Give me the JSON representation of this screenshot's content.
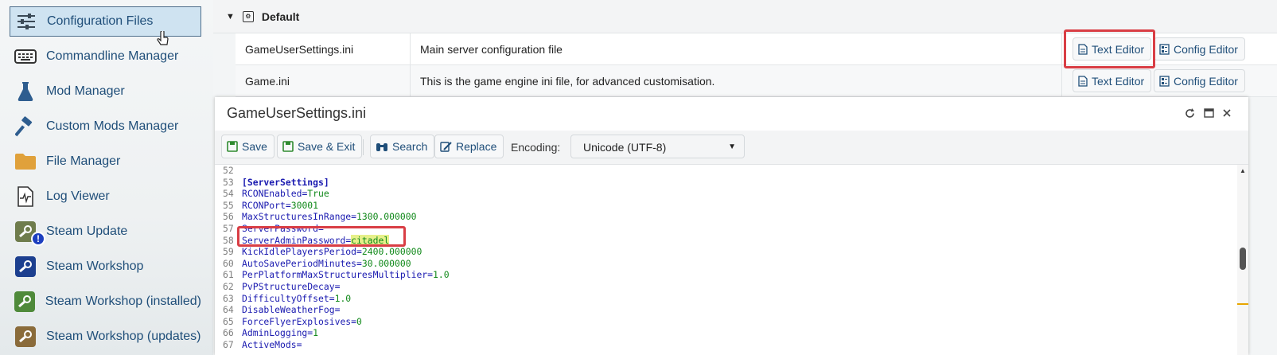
{
  "sidebar": {
    "items": [
      {
        "label": "Configuration Files",
        "icon": "sliders-icon",
        "active": true
      },
      {
        "label": "Commandline Manager",
        "icon": "keyboard-icon"
      },
      {
        "label": "Mod Manager",
        "icon": "flask-icon"
      },
      {
        "label": "Custom Mods Manager",
        "icon": "hammer-icon"
      },
      {
        "label": "File Manager",
        "icon": "folder-icon"
      },
      {
        "label": "Log Viewer",
        "icon": "log-file-icon"
      },
      {
        "label": "Steam Update",
        "icon": "steam-update-icon",
        "badge": "!"
      },
      {
        "label": "Steam Workshop",
        "icon": "steam-workshop-icon"
      },
      {
        "label": "Steam Workshop (installed)",
        "icon": "steam-workshop-installed-icon"
      },
      {
        "label": "Steam Workshop (updates)",
        "icon": "steam-workshop-updates-icon"
      }
    ]
  },
  "config": {
    "group_label": "Default",
    "files": [
      {
        "name": "GameUserSettings.ini",
        "description": "Main server configuration file",
        "text_editor": "Text Editor",
        "config_editor": "Config Editor"
      },
      {
        "name": "Game.ini",
        "description": "This is the game engine ini file, for advanced customisation.",
        "text_editor": "Text Editor",
        "config_editor": "Config Editor"
      }
    ]
  },
  "editor": {
    "title": "GameUserSettings.ini",
    "toolbar": {
      "save": "Save",
      "save_exit": "Save & Exit",
      "search": "Search",
      "replace": "Replace",
      "encoding_label": "Encoding:",
      "encoding_value": "Unicode (UTF-8)"
    },
    "lines": [
      {
        "n": "52",
        "key": "",
        "val": ""
      },
      {
        "n": "53",
        "key": "[ServerSettings]",
        "val": ""
      },
      {
        "n": "54",
        "key": "RCONEnabled",
        "val": "True"
      },
      {
        "n": "55",
        "key": "RCONPort",
        "val": "30001"
      },
      {
        "n": "56",
        "key": "MaxStructuresInRange",
        "val": "1300.000000"
      },
      {
        "n": "57",
        "key": "ServerPassword",
        "val": ""
      },
      {
        "n": "58",
        "key": "ServerAdminPassword",
        "val": "citadel"
      },
      {
        "n": "59",
        "key": "KickIdlePlayersPeriod",
        "val": "2400.000000"
      },
      {
        "n": "60",
        "key": "AutoSavePeriodMinutes",
        "val": "30.000000"
      },
      {
        "n": "61",
        "key": "PerPlatformMaxStructuresMultiplier",
        "val": "1.0"
      },
      {
        "n": "62",
        "key": "PvPStructureDecay",
        "val": ""
      },
      {
        "n": "63",
        "key": "DifficultyOffset",
        "val": "1.0"
      },
      {
        "n": "64",
        "key": "DisableWeatherFog",
        "val": ""
      },
      {
        "n": "65",
        "key": "ForceFlyerExplosives",
        "val": "0"
      },
      {
        "n": "66",
        "key": "AdminLogging",
        "val": "1"
      },
      {
        "n": "67",
        "key": "ActiveMods",
        "val": ""
      }
    ]
  },
  "colors": {
    "accent": "#1f4e79",
    "highlight_box": "#d93e45",
    "code_key": "#1a1ab0",
    "code_value": "#11891a",
    "match_background": "#e6f08a"
  }
}
